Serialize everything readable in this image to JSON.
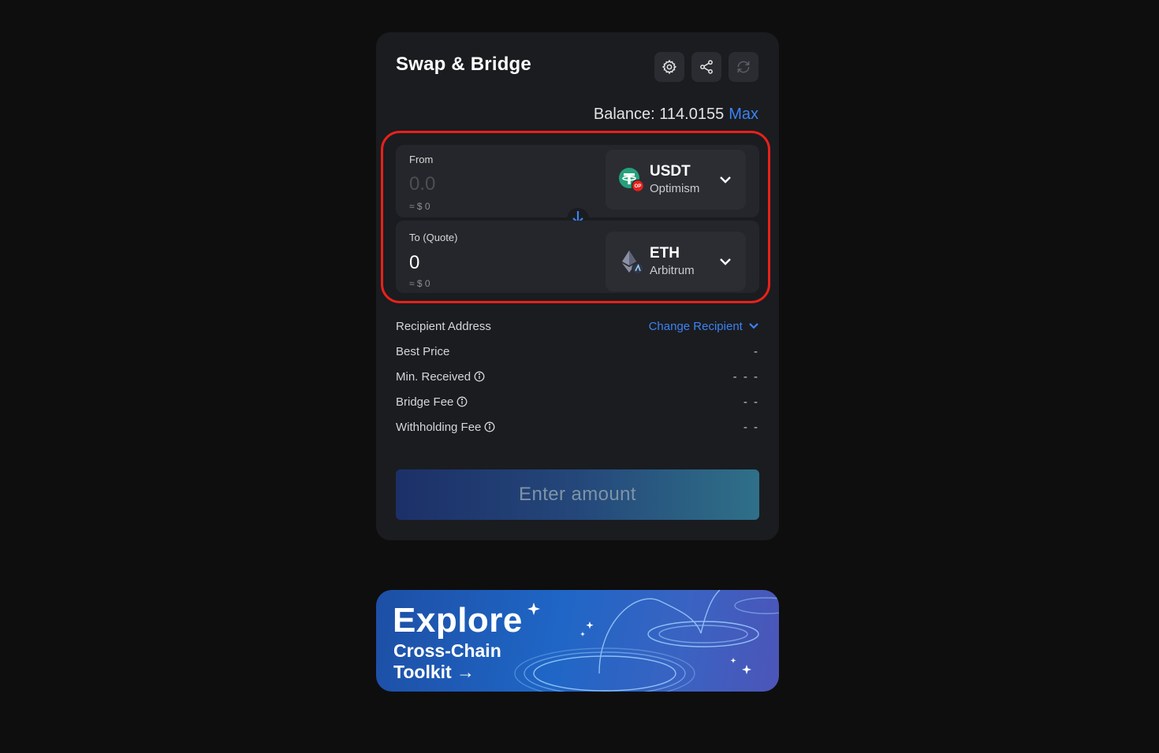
{
  "header": {
    "title": "Swap & Bridge",
    "settings_icon": "gear-icon",
    "share_icon": "share-icon",
    "refresh_icon": "refresh-icon"
  },
  "balance": {
    "label": "Balance: 114.0155",
    "max_label": "Max"
  },
  "from": {
    "label": "From",
    "amount_placeholder": "0.0",
    "usd": "≈ $ 0",
    "token": {
      "symbol": "USDT",
      "network": "Optimism",
      "icon": "usdt-icon",
      "badge": "OP"
    }
  },
  "to": {
    "label": "To (Quote)",
    "amount": "0",
    "usd": "≈ $ 0",
    "token": {
      "symbol": "ETH",
      "network": "Arbitrum",
      "icon": "eth-icon"
    }
  },
  "details": {
    "recipient_label": "Recipient Address",
    "change_recipient": "Change Recipient",
    "best_price_label": "Best Price",
    "best_price_value": "-",
    "min_received_label": "Min. Received",
    "min_received_value": "- - -",
    "bridge_fee_label": "Bridge Fee",
    "bridge_fee_value": "- -",
    "withholding_fee_label": "Withholding Fee",
    "withholding_fee_value": "- -"
  },
  "action": {
    "button_label": "Enter amount"
  },
  "banner": {
    "line1": "Explore",
    "line2": "Cross-Chain",
    "line3": "Toolkit →"
  },
  "colors": {
    "background": "#0e0e0e",
    "card": "#1a1c20",
    "accent": "#3d82f0",
    "highlight": "#e8211a"
  }
}
